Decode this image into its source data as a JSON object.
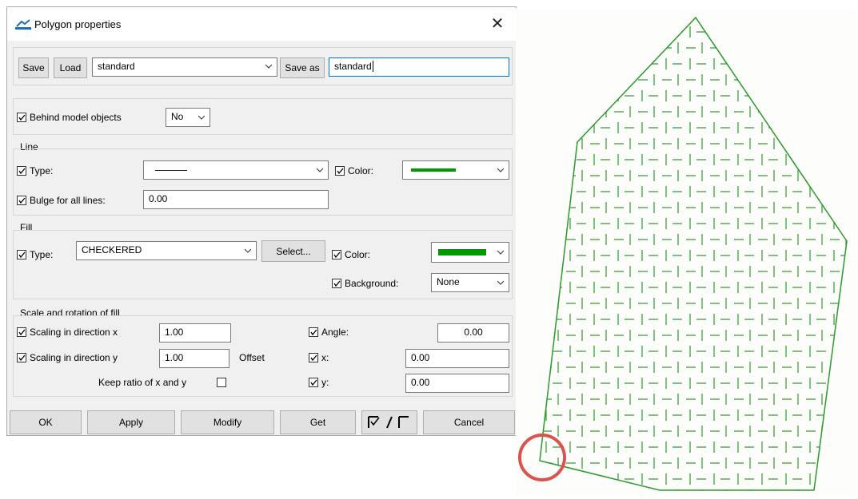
{
  "window": {
    "title": "Polygon properties",
    "close_glyph": "✕"
  },
  "toolbar": {
    "save_label": "Save",
    "load_label": "Load",
    "preset_value": "standard",
    "save_as_label": "Save as",
    "save_as_value": "standard"
  },
  "behind": {
    "label": "Behind model objects",
    "value": "No"
  },
  "line": {
    "group_label": "Line",
    "type_label": "Type:",
    "color_label": "Color:",
    "bulge_label": "Bulge for all lines:",
    "bulge_value": "0.00",
    "color": "#009a00"
  },
  "fill": {
    "group_label": "Fill",
    "type_label": "Type:",
    "type_value": "CHECKERED",
    "select_label": "Select...",
    "color_label": "Color:",
    "background_label": "Background:",
    "background_value": "None",
    "color": "#009a00"
  },
  "scale": {
    "group_label": "Scale and rotation of fill",
    "scale_x_label": "Scaling in direction x",
    "scale_x_value": "1.00",
    "scale_y_label": "Scaling in direction y",
    "scale_y_value": "1.00",
    "offset_label": "Offset",
    "angle_label": "Angle:",
    "angle_value": "0.00",
    "x_label": "x:",
    "x_value": "0.00",
    "y_label": "y:",
    "y_value": "0.00",
    "keep_ratio_label": "Keep ratio of x and y"
  },
  "buttons": {
    "ok": "OK",
    "apply": "Apply",
    "modify": "Modify",
    "get": "Get",
    "cancel": "Cancel"
  },
  "drawing": {
    "outline_color": "#2a9a2a",
    "highlight_color": "#d9534f"
  }
}
